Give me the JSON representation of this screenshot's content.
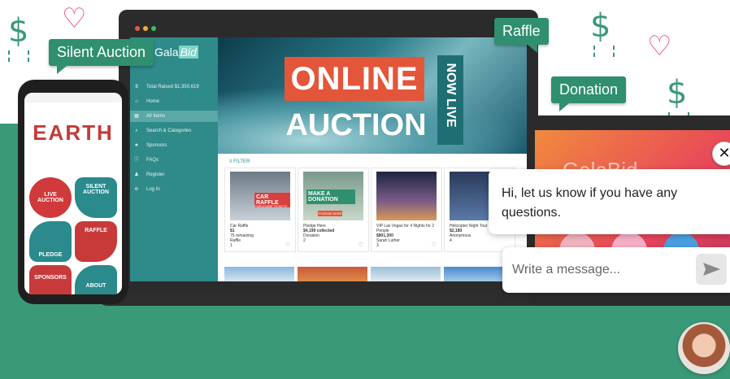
{
  "colors": {
    "brand_green": "#3a9a78",
    "heart_pink": "#e94c7a",
    "sidebar_teal": "#2f8a8a",
    "online_red": "#e4563a"
  },
  "bubbles": {
    "silent": "Silent Auction",
    "raffle": "Raffle",
    "donation": "Donation"
  },
  "laptop": {
    "logo_a": "Gala",
    "logo_b": "Bid",
    "menu": [
      {
        "icon": "dollar-icon",
        "glyph": "$",
        "label": "Total Raised $1,350,619"
      },
      {
        "icon": "home-icon",
        "glyph": "⌂",
        "label": "Home"
      },
      {
        "icon": "grid-icon",
        "glyph": "▦",
        "label": "All Items"
      },
      {
        "icon": "search-icon",
        "glyph": "⌕",
        "label": "Search & Categories"
      },
      {
        "icon": "star-icon",
        "glyph": "★",
        "label": "Sponsors"
      },
      {
        "icon": "info-icon",
        "glyph": "ⓘ",
        "label": "FAQs"
      },
      {
        "icon": "user-add-icon",
        "glyph": "♟",
        "label": "Register"
      },
      {
        "icon": "login-icon",
        "glyph": "⎆",
        "label": "Log In"
      }
    ],
    "hero": {
      "online": "ONLINE",
      "auction": "AUCTION",
      "now_live": "NOW LIVE"
    },
    "filter": "FILTER",
    "cards": [
      {
        "badge": "CAR RAFFLE",
        "badge_sub": "PURCHASE TICKETS",
        "title": "Car Raffle",
        "value": "$1",
        "sub": "75 remaining",
        "cat": "Raffle",
        "num": "1"
      },
      {
        "badge": "MAKE A DONATION",
        "badge_sub": "PLEDGE HERE",
        "title": "Pledge Here",
        "value": "$4,199 collected",
        "sub": "",
        "cat": "Donation",
        "num": "2"
      },
      {
        "badge": "",
        "badge_sub": "",
        "title": "VIP Las Vegas for 4 Nights for 2 People",
        "value": "$801,300",
        "sub": "",
        "cat": "Sarah Luther",
        "num": "3"
      },
      {
        "badge": "",
        "badge_sub": "",
        "title": "Helicopter Night Tour",
        "value": "$2,180",
        "sub": "",
        "cat": "Anonymous",
        "num": "4"
      }
    ]
  },
  "phone": {
    "title": "EARTH",
    "tiles": [
      {
        "label": "LIVE AUCTION"
      },
      {
        "label": "SILENT AUCTION"
      },
      {
        "label": "RAFFLE"
      },
      {
        "label": "PLEDGE"
      },
      {
        "label": "SPONSORS"
      },
      {
        "label": "ABOUT"
      }
    ]
  },
  "tablet": {
    "logo": "GalaBid"
  },
  "chat": {
    "message": "Hi, let us know if you have any questions.",
    "input_placeholder": "Write a message...",
    "close_glyph": "✕",
    "send_icon": "send-icon"
  }
}
